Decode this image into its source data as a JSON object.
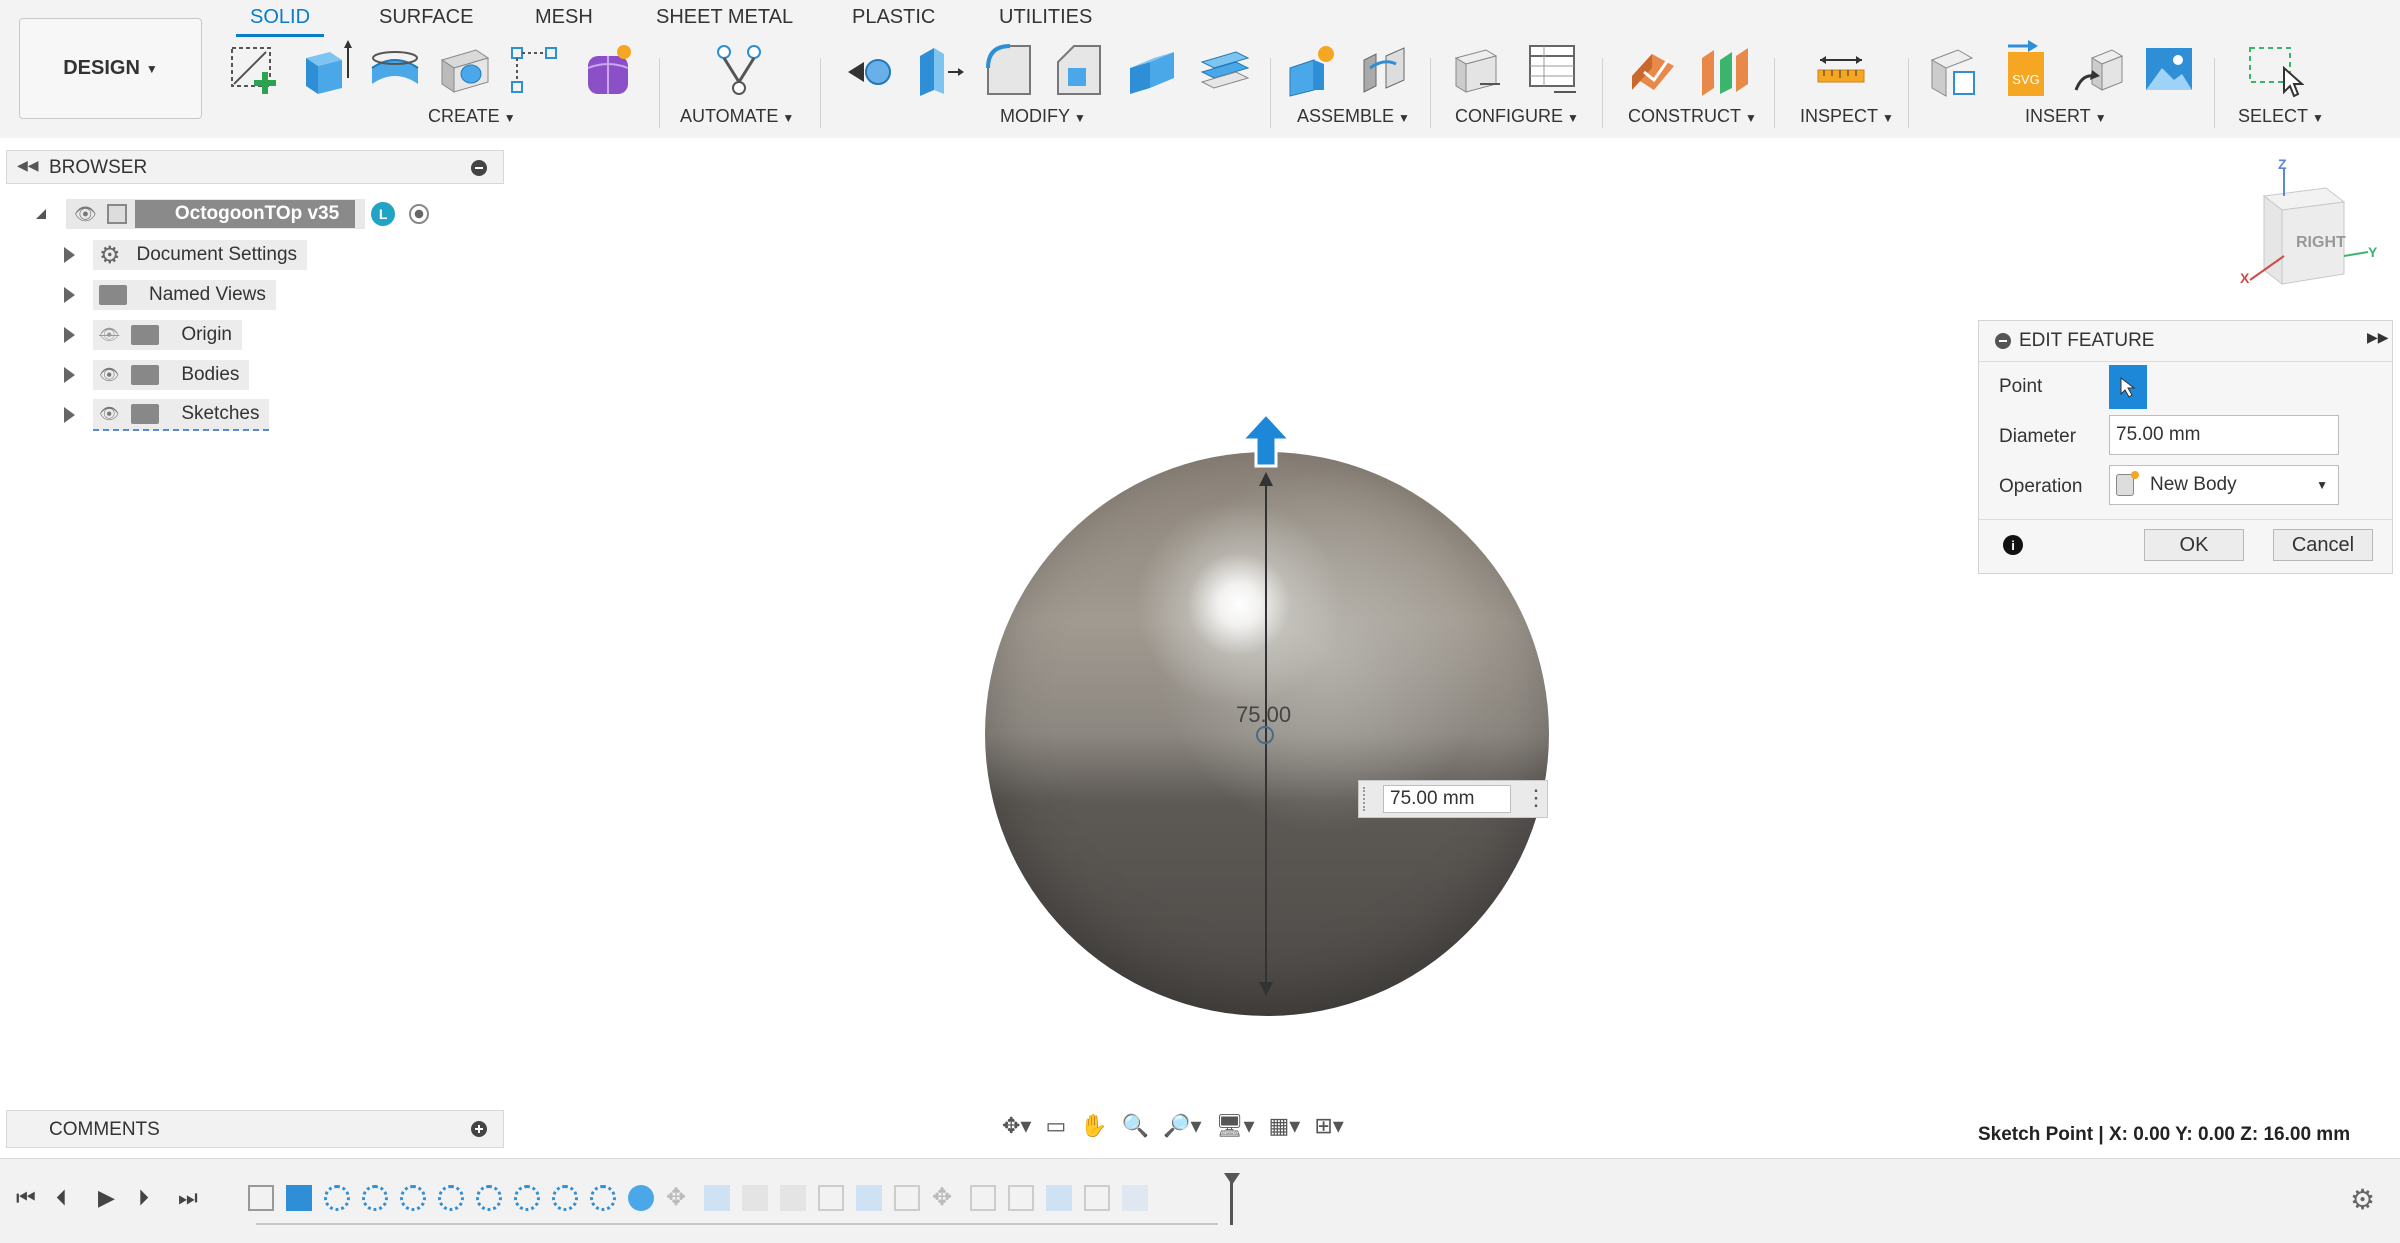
{
  "workspace": {
    "label": "DESIGN"
  },
  "tabs": [
    {
      "label": "SOLID"
    },
    {
      "label": "SURFACE"
    },
    {
      "label": "MESH"
    },
    {
      "label": "SHEET METAL"
    },
    {
      "label": "PLASTIC"
    },
    {
      "label": "UTILITIES"
    }
  ],
  "groups": {
    "create": "CREATE",
    "automate": "AUTOMATE",
    "modify": "MODIFY",
    "assemble": "ASSEMBLE",
    "configure": "CONFIGURE",
    "construct": "CONSTRUCT",
    "inspect": "INSPECT",
    "insert": "INSERT",
    "select": "SELECT"
  },
  "browser": {
    "title": "BROWSER",
    "root": "OctogoonTOp v35",
    "root_badge": "L",
    "items": [
      {
        "label": "Document Settings",
        "icon": "gear-icon"
      },
      {
        "label": "Named Views",
        "icon": "folder-icon"
      },
      {
        "label": "Origin",
        "icon": "folder-icon"
      },
      {
        "label": "Bodies",
        "icon": "folder-icon"
      },
      {
        "label": "Sketches",
        "icon": "folder-icon"
      }
    ]
  },
  "viewcube": {
    "face": "RIGHT",
    "axis_x": "X",
    "axis_y": "Y",
    "axis_z": "Z"
  },
  "viewport": {
    "dimension_label": "75.00",
    "diameter_input": "75.00 mm"
  },
  "edit_feature": {
    "title": "EDIT FEATURE",
    "point_label": "Point",
    "diameter_label": "Diameter",
    "diameter_value": "75.00 mm",
    "operation_label": "Operation",
    "operation_value": "New Body",
    "ok_label": "OK",
    "cancel_label": "Cancel"
  },
  "comments": {
    "title": "COMMENTS"
  },
  "status": {
    "text": "Sketch Point | X: 0.00 Y: 0.00 Z: 16.00 mm"
  },
  "colors": {
    "accent": "#0a7ccc",
    "selected_tool": "#1e88d8"
  }
}
